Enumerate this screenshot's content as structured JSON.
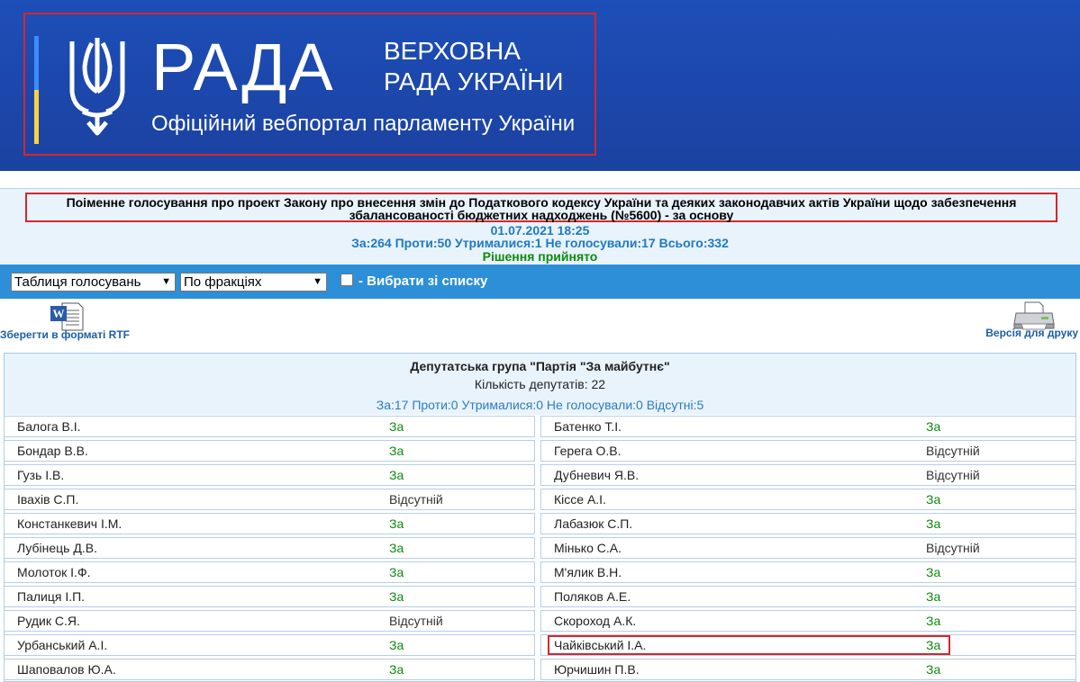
{
  "header": {
    "logo_text": "РАДА",
    "subtitle_line1": "ВЕРХОВНА",
    "subtitle_line2": "РАДА УКРАЇНИ",
    "portal_text": "Офіційний вебпортал парламенту України"
  },
  "vote": {
    "title_line1": "Поіменне голосування про проект Закону про внесення змін до Податкового кодексу України та деяких законодавчих актів України щодо забезпечення",
    "title_line2": "збалансованості бюджетних надходжень (№5600) - за основу",
    "datetime": "01.07.2021 18:25",
    "totals": "За:264 Проти:50 Утрималися:1 Не голосували:17 Всього:332",
    "result": "Рішення прийнято"
  },
  "toolbar": {
    "view_select": "Таблиця голосувань",
    "group_select": "По фракціях",
    "select_from_list": "- Вибрати зі списку"
  },
  "actions": {
    "save_rtf": "Зберегти в форматі RTF",
    "print_version": "Версія для друку"
  },
  "faction": {
    "name": "Депутатська група \"Партія \"За майбутнє\"",
    "count": "Кількість депутатів: 22",
    "stats": "За:17 Проти:0 Утрималися:0 Не голосували:0 Відсутні:5"
  },
  "deputies_left": [
    {
      "name": "Балога В.І.",
      "vote": "За"
    },
    {
      "name": "Бондар В.В.",
      "vote": "За"
    },
    {
      "name": "Гузь І.В.",
      "vote": "За"
    },
    {
      "name": "Іваxів С.П.",
      "vote": "Відсутній"
    },
    {
      "name": "Констанкевич І.М.",
      "vote": "За"
    },
    {
      "name": "Лубінець Д.В.",
      "vote": "За"
    },
    {
      "name": "Молоток І.Ф.",
      "vote": "За"
    },
    {
      "name": "Палиця І.П.",
      "vote": "За"
    },
    {
      "name": "Рудик С.Я.",
      "vote": "Відсутній"
    },
    {
      "name": "Урбанський А.І.",
      "vote": "За"
    },
    {
      "name": "Шаповалов Ю.А.",
      "vote": "За"
    }
  ],
  "deputies_right": [
    {
      "name": "Батенко Т.І.",
      "vote": "За"
    },
    {
      "name": "Герега О.В.",
      "vote": "Відсутній"
    },
    {
      "name": "Дубневич Я.В.",
      "vote": "Відсутній"
    },
    {
      "name": "Кіссе А.І.",
      "vote": "За"
    },
    {
      "name": "Лабазюк С.П.",
      "vote": "За"
    },
    {
      "name": "Мінько С.А.",
      "vote": "Відсутній"
    },
    {
      "name": "М'ялик В.Н.",
      "vote": "За"
    },
    {
      "name": "Поляков А.Е.",
      "vote": "За"
    },
    {
      "name": "Скороход А.К.",
      "vote": "За"
    },
    {
      "name": "Чайківський І.А.",
      "vote": "За"
    },
    {
      "name": "Юрчишин П.В.",
      "vote": "За"
    }
  ],
  "colors": {
    "header_blue": "#1c46aa",
    "toolbar_blue": "#2d8fd8",
    "vote_yes": "#0e8a0e",
    "highlight_red": "#d6262b"
  }
}
